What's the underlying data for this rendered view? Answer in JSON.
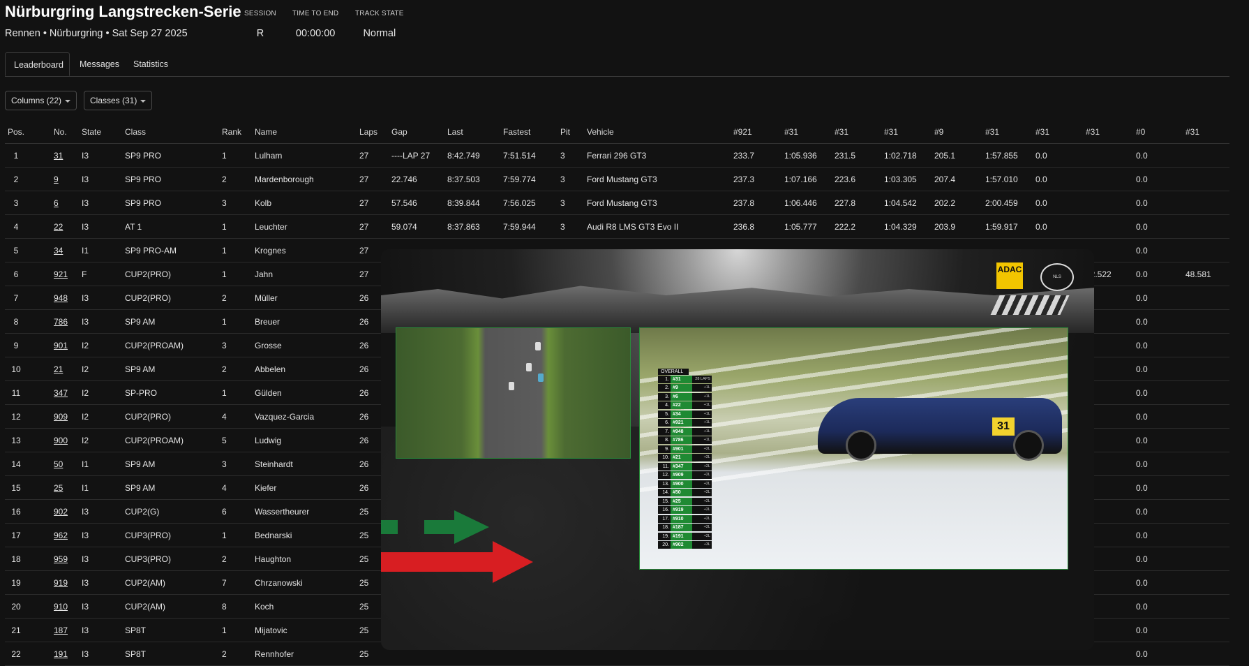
{
  "header": {
    "title": "Nürburgring Langstrecken-Serie",
    "subtitle": "Rennen • Nürburgring • Sat Sep 27 2025",
    "stats": [
      {
        "label": "SESSION",
        "value": "R"
      },
      {
        "label": "TIME TO END",
        "value": "00:00:00"
      },
      {
        "label": "TRACK STATE",
        "value": "Normal"
      }
    ]
  },
  "tabs": [
    "Leaderboard",
    "Messages",
    "Statistics"
  ],
  "filters": {
    "columns": "Columns (22)",
    "classes": "Classes (31)"
  },
  "table": {
    "headers": [
      "Pos.",
      "No.",
      "State",
      "Class",
      "Rank",
      "Name",
      "Laps",
      "Gap",
      "Last",
      "Fastest",
      "Pit",
      "Vehicle",
      "#921",
      "#31",
      "#31",
      "#31",
      "#9",
      "#31",
      "#31",
      "#31",
      "#0",
      "#31"
    ],
    "rows": [
      [
        "1",
        "31",
        "I3",
        "SP9 PRO",
        "1",
        "Lulham",
        "27",
        "----LAP 27",
        "8:42.749",
        "7:51.514",
        "3",
        "Ferrari 296 GT3",
        "233.7",
        "1:05.936",
        "231.5",
        "1:02.718",
        "205.1",
        "1:57.855",
        "0.0",
        "",
        "0.0",
        ""
      ],
      [
        "2",
        "9",
        "I3",
        "SP9 PRO",
        "2",
        "Mardenborough",
        "27",
        "22.746",
        "8:37.503",
        "7:59.774",
        "3",
        "Ford Mustang GT3",
        "237.3",
        "1:07.166",
        "223.6",
        "1:03.305",
        "207.4",
        "1:57.010",
        "0.0",
        "",
        "0.0",
        ""
      ],
      [
        "3",
        "6",
        "I3",
        "SP9 PRO",
        "3",
        "Kolb",
        "27",
        "57.546",
        "8:39.844",
        "7:56.025",
        "3",
        "Ford Mustang GT3",
        "237.8",
        "1:06.446",
        "227.8",
        "1:04.542",
        "202.2",
        "2:00.459",
        "0.0",
        "",
        "0.0",
        ""
      ],
      [
        "4",
        "22",
        "I3",
        "AT 1",
        "1",
        "Leuchter",
        "27",
        "59.074",
        "8:37.863",
        "7:59.944",
        "3",
        "Audi R8 LMS GT3 Evo II",
        "236.8",
        "1:05.777",
        "222.2",
        "1:04.329",
        "203.9",
        "1:59.917",
        "0.0",
        "",
        "0.0",
        ""
      ],
      [
        "5",
        "34",
        "I1",
        "SP9 PRO-AM",
        "1",
        "Krognes",
        "27",
        "",
        "",
        "",
        "",
        "",
        "",
        "",
        "",
        "",
        "",
        "",
        "",
        "",
        "0.0",
        ""
      ],
      [
        "6",
        "921",
        "F",
        "CUP2(PRO)",
        "1",
        "Jahn",
        "27",
        "",
        "",
        "",
        "",
        "",
        "",
        "",
        "",
        "",
        "",
        "",
        "",
        "42.522",
        "0.0",
        "48.581"
      ],
      [
        "7",
        "948",
        "I3",
        "CUP2(PRO)",
        "2",
        "Müller",
        "26",
        "",
        "",
        "",
        "",
        "",
        "",
        "",
        "",
        "",
        "",
        "",
        "",
        "",
        "0.0",
        ""
      ],
      [
        "8",
        "786",
        "I3",
        "SP9 AM",
        "1",
        "Breuer",
        "26",
        "",
        "",
        "",
        "",
        "",
        "",
        "",
        "",
        "",
        "",
        "",
        "",
        "",
        "0.0",
        ""
      ],
      [
        "9",
        "901",
        "I2",
        "CUP2(PROAM)",
        "3",
        "Grosse",
        "26",
        "",
        "",
        "",
        "",
        "",
        "",
        "",
        "",
        "",
        "",
        "",
        "",
        "",
        "0.0",
        ""
      ],
      [
        "10",
        "21",
        "I2",
        "SP9 AM",
        "2",
        "Abbelen",
        "26",
        "",
        "",
        "",
        "",
        "",
        "",
        "",
        "",
        "",
        "",
        "",
        "",
        "",
        "0.0",
        ""
      ],
      [
        "11",
        "347",
        "I2",
        "SP-PRO",
        "1",
        "Gülden",
        "26",
        "",
        "",
        "",
        "",
        "",
        "",
        "",
        "",
        "",
        "",
        "",
        "",
        "",
        "0.0",
        ""
      ],
      [
        "12",
        "909",
        "I2",
        "CUP2(PRO)",
        "4",
        "Vazquez-Garcia",
        "26",
        "",
        "",
        "",
        "",
        "",
        "",
        "",
        "",
        "",
        "",
        "",
        "",
        "",
        "0.0",
        ""
      ],
      [
        "13",
        "900",
        "I2",
        "CUP2(PROAM)",
        "5",
        "Ludwig",
        "26",
        "",
        "",
        "",
        "",
        "",
        "",
        "",
        "",
        "",
        "",
        "",
        "",
        "",
        "0.0",
        ""
      ],
      [
        "14",
        "50",
        "I1",
        "SP9 AM",
        "3",
        "Steinhardt",
        "26",
        "",
        "",
        "",
        "",
        "",
        "",
        "",
        "",
        "",
        "",
        "",
        "",
        "",
        "0.0",
        ""
      ],
      [
        "15",
        "25",
        "I1",
        "SP9 AM",
        "4",
        "Kiefer",
        "26",
        "",
        "",
        "",
        "",
        "",
        "",
        "",
        "",
        "",
        "",
        "",
        "",
        "",
        "0.0",
        ""
      ],
      [
        "16",
        "902",
        "I3",
        "CUP2(G)",
        "6",
        "Wassertheurer",
        "25",
        "",
        "",
        "",
        "",
        "",
        "",
        "",
        "",
        "",
        "",
        "",
        "",
        "",
        "0.0",
        ""
      ],
      [
        "17",
        "962",
        "I3",
        "CUP3(PRO)",
        "1",
        "Bednarski",
        "25",
        "",
        "",
        "",
        "",
        "",
        "",
        "",
        "",
        "",
        "",
        "",
        "",
        "",
        "0.0",
        ""
      ],
      [
        "18",
        "959",
        "I3",
        "CUP3(PRO)",
        "2",
        "Haughton",
        "25",
        "",
        "",
        "",
        "",
        "",
        "",
        "",
        "",
        "",
        "",
        "",
        "",
        "",
        "0.0",
        ""
      ],
      [
        "19",
        "919",
        "I3",
        "CUP2(AM)",
        "7",
        "Chrzanowski",
        "25",
        "",
        "",
        "",
        "",
        "",
        "",
        "",
        "",
        "",
        "",
        "",
        "",
        "",
        "0.0",
        ""
      ],
      [
        "20",
        "910",
        "I3",
        "CUP2(AM)",
        "8",
        "Koch",
        "25",
        "",
        "",
        "",
        "",
        "",
        "",
        "",
        "",
        "",
        "",
        "",
        "",
        "",
        "0.0",
        ""
      ],
      [
        "21",
        "187",
        "I3",
        "SP8T",
        "1",
        "Mijatovic",
        "25",
        "",
        "",
        "",
        "",
        "",
        "",
        "",
        "",
        "",
        "",
        "",
        "",
        "",
        "0.0",
        ""
      ],
      [
        "22",
        "191",
        "I3",
        "SP8T",
        "2",
        "Rennhofer",
        "25",
        "",
        "",
        "",
        "",
        "",
        "",
        "",
        "",
        "",
        "",
        "",
        "",
        "",
        "0.0",
        ""
      ]
    ]
  },
  "video": {
    "logos": {
      "adac": "ADAC",
      "nls": "Nürburgring Langstrecken-Serie"
    },
    "car_number": "31",
    "overall": {
      "title": "OVERALL",
      "rows": [
        [
          "1.",
          "#31",
          "28 LAPS"
        ],
        [
          "2.",
          "#9",
          "+1L"
        ],
        [
          "3.",
          "#6",
          "+1L"
        ],
        [
          "4.",
          "#22",
          "+1L"
        ],
        [
          "5.",
          "#34",
          "+1L"
        ],
        [
          "6.",
          "#921",
          "+1L"
        ],
        [
          "7.",
          "#948",
          "+1L"
        ],
        [
          "8.",
          "#786",
          "+1L"
        ],
        [
          "9.",
          "#901",
          "+2L"
        ],
        [
          "10.",
          "#21",
          "+2L"
        ],
        [
          "11.",
          "#347",
          "+2L"
        ],
        [
          "12.",
          "#909",
          "+2L"
        ],
        [
          "13.",
          "#900",
          "+2L"
        ],
        [
          "14.",
          "#50",
          "+2L"
        ],
        [
          "15.",
          "#25",
          "+2L"
        ],
        [
          "16.",
          "#919",
          "+2L"
        ],
        [
          "17.",
          "#910",
          "+2L"
        ],
        [
          "18.",
          "#187",
          "+2L"
        ],
        [
          "19.",
          "#191",
          "+2L"
        ],
        [
          "20.",
          "#902",
          "+3L"
        ]
      ]
    }
  },
  "colors": {
    "background": "#121212",
    "accent_green": "#1f8a33",
    "arrow_red": "#d81e22",
    "arrow_green": "#1a7a3a",
    "adac_yellow": "#f2c500"
  }
}
